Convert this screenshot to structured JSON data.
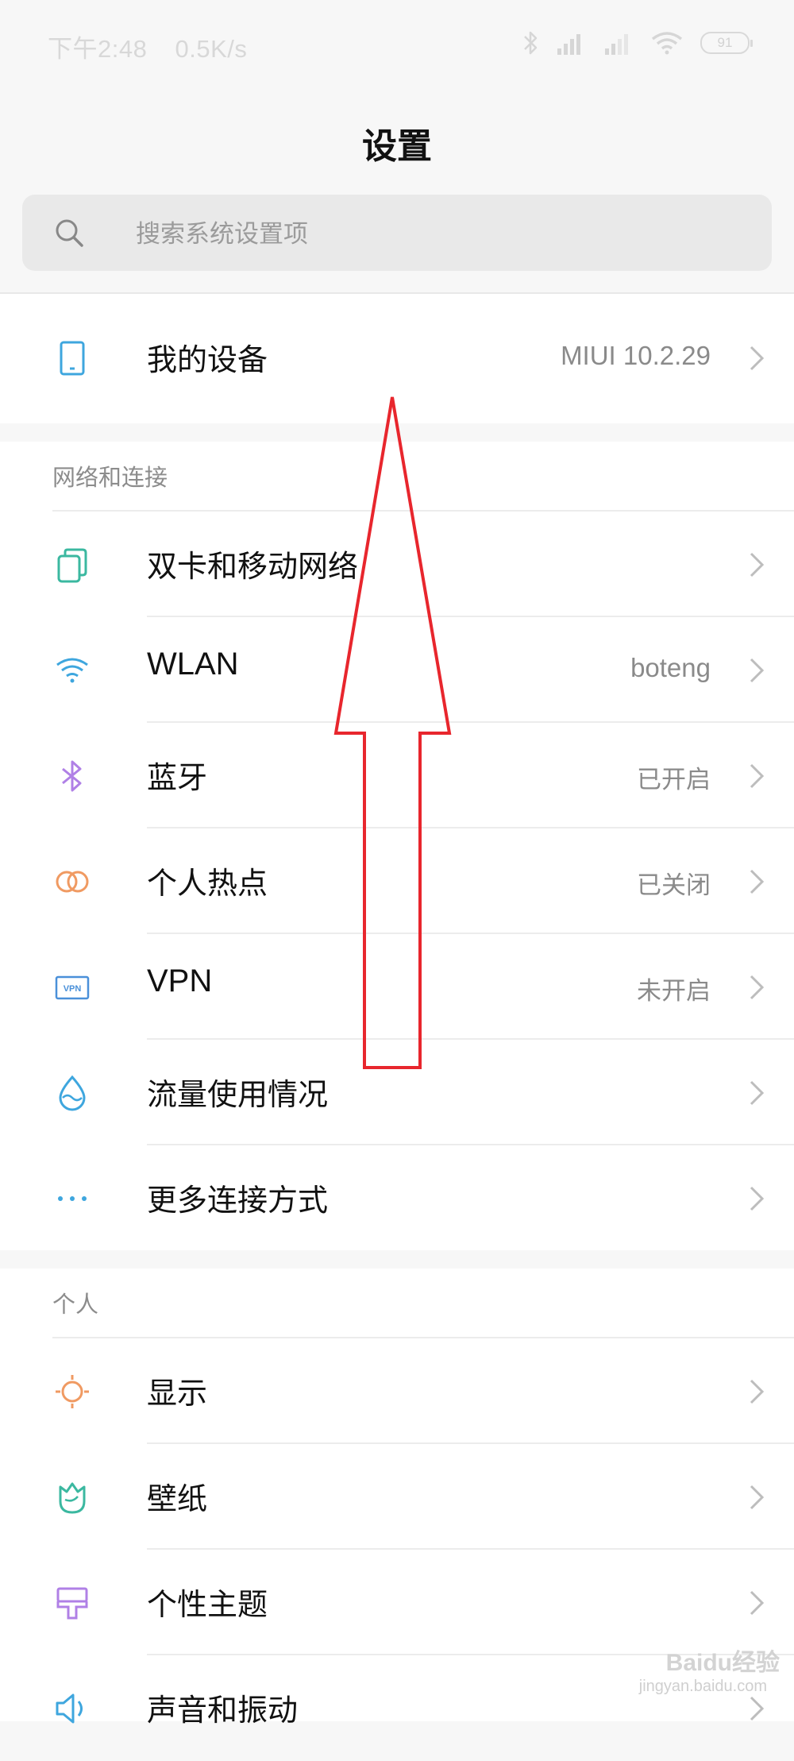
{
  "status_bar": {
    "time": "下午2:48",
    "speed": "0.5K/s",
    "battery": "91"
  },
  "page": {
    "title": "设置",
    "search_placeholder": "搜索系统设置项"
  },
  "device": {
    "label": "我的设备",
    "value": "MIUI 10.2.29"
  },
  "network": {
    "header": "网络和连接",
    "items": [
      {
        "label": "双卡和移动网络",
        "value": "",
        "icon": "sim-card-icon"
      },
      {
        "label": "WLAN",
        "value": "boteng",
        "icon": "wifi-icon"
      },
      {
        "label": "蓝牙",
        "value": "已开启",
        "icon": "bluetooth-icon"
      },
      {
        "label": "个人热点",
        "value": "已关闭",
        "icon": "hotspot-icon"
      },
      {
        "label": "VPN",
        "value": "未开启",
        "icon": "vpn-icon"
      },
      {
        "label": "流量使用情况",
        "value": "",
        "icon": "data-usage-icon"
      },
      {
        "label": "更多连接方式",
        "value": "",
        "icon": "more-dots-icon"
      }
    ]
  },
  "personal": {
    "header": "个人",
    "items": [
      {
        "label": "显示",
        "icon": "display-sun-icon"
      },
      {
        "label": "壁纸",
        "icon": "wallpaper-tulip-icon"
      },
      {
        "label": "个性主题",
        "icon": "theme-brush-icon"
      },
      {
        "label": "声音和振动",
        "icon": "sound-speaker-icon"
      }
    ]
  },
  "watermark": {
    "brand": "Baidu经验",
    "url": "jingyan.baidu.com"
  },
  "colors": {
    "annotation_arrow": "#e8262d",
    "sim": "#3bb8a0",
    "wifi": "#3ea6de",
    "bluetooth": "#b080e6",
    "hotspot": "#f09a62",
    "vpn": "#4a90d9",
    "data": "#3ea6de",
    "more": "#3ea6de",
    "display": "#f09a62",
    "wallpaper": "#3bb8a0",
    "theme": "#b080e6",
    "sound": "#3ea6de"
  }
}
